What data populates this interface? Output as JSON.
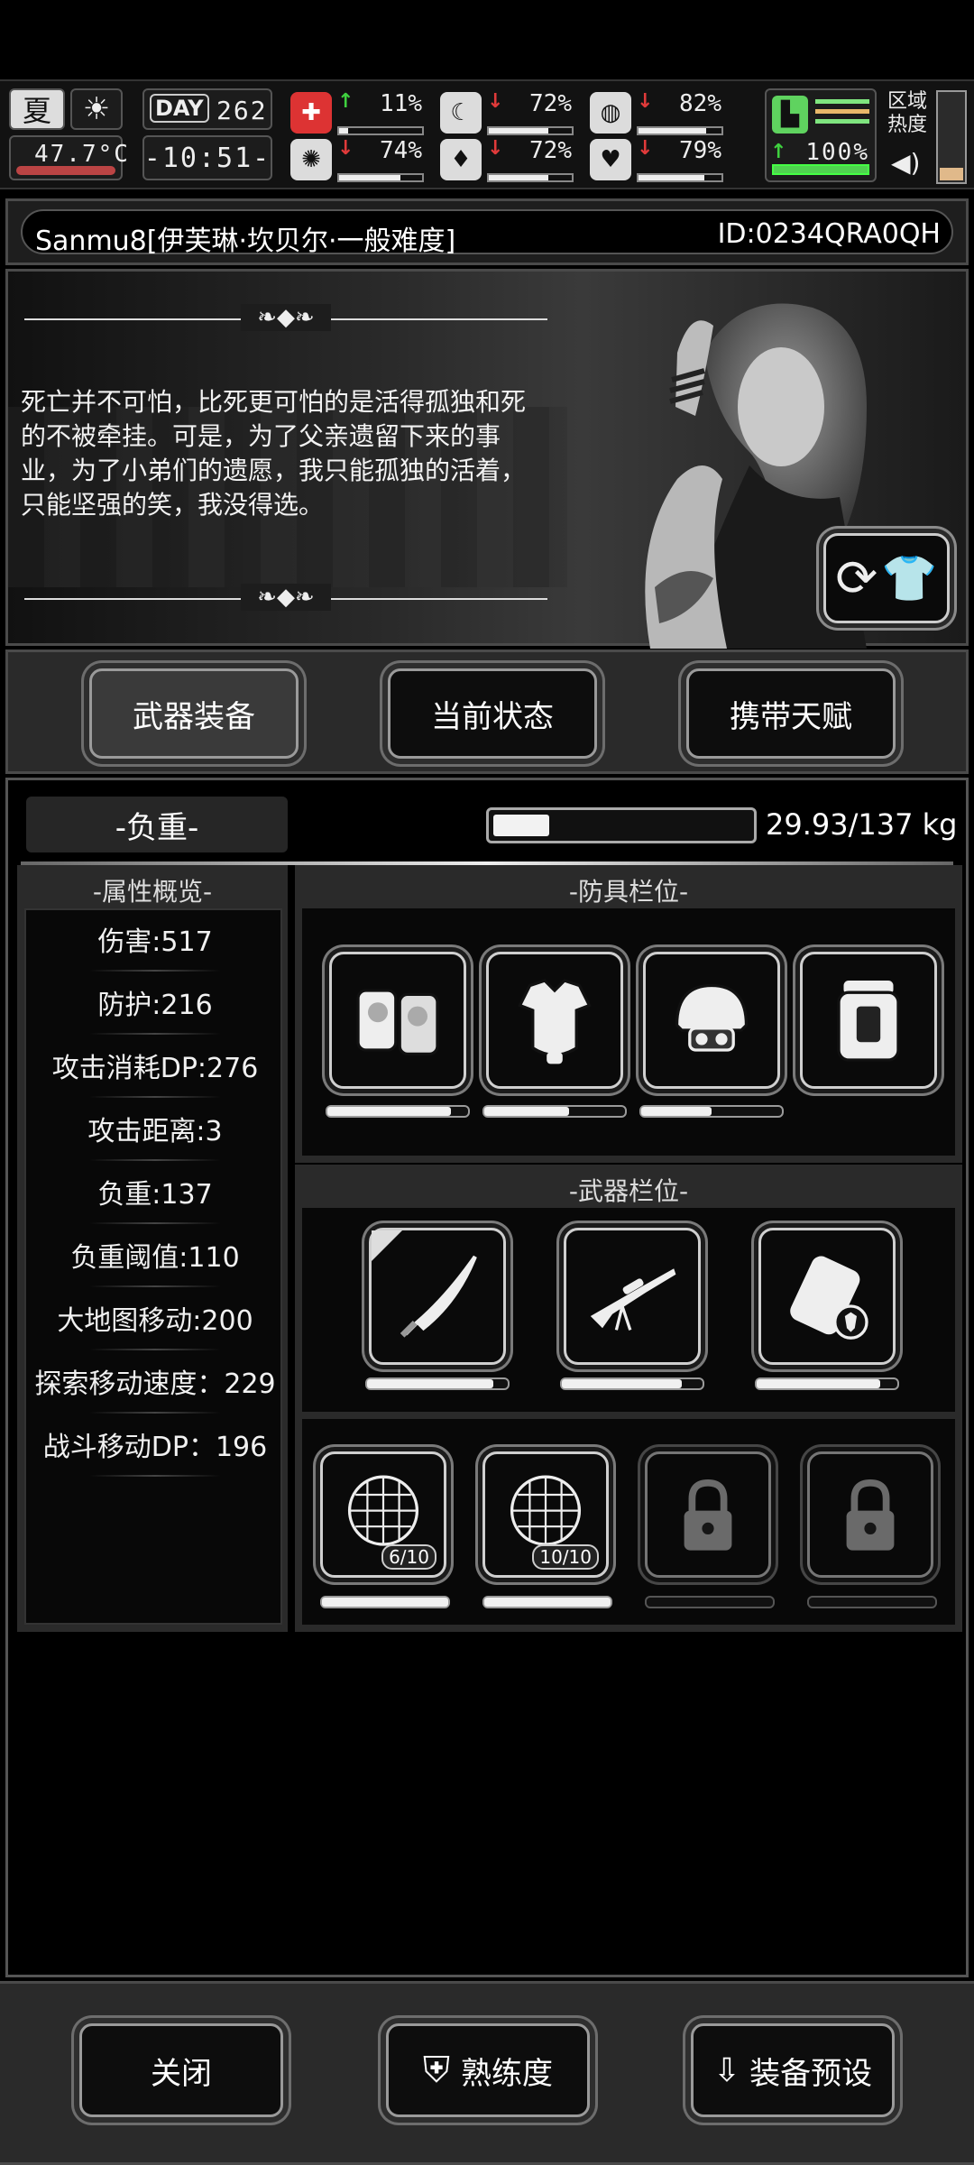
{
  "hud": {
    "season": "夏",
    "temperature": "47.7°C",
    "day_label": "DAY",
    "day_number": "262",
    "time": "-10:51-",
    "stats": [
      {
        "icon": "medkit-icon",
        "glyph": "✚",
        "arrow": "↑",
        "arrow_color": "#3fd13f",
        "value": "11%",
        "level": 0.11
      },
      {
        "icon": "stomach-icon",
        "glyph": "☾",
        "arrow": "↓",
        "arrow_color": "#e03a3a",
        "value": "72%",
        "level": 0.72
      },
      {
        "icon": "pill-icon",
        "glyph": "◍",
        "arrow": "↓",
        "arrow_color": "#e03a3a",
        "value": "82%",
        "level": 0.82
      },
      {
        "icon": "brain-icon",
        "glyph": "✺",
        "arrow": "↓",
        "arrow_color": "#e03a3a",
        "value": "74%",
        "level": 0.74
      },
      {
        "icon": "water-drop-icon",
        "glyph": "♦",
        "arrow": "↓",
        "arrow_color": "#e03a3a",
        "value": "72%",
        "level": 0.72
      },
      {
        "icon": "heart-icon",
        "glyph": "♥",
        "arrow": "↓",
        "arrow_color": "#e03a3a",
        "value": "79%",
        "level": 0.79
      }
    ],
    "stamina": {
      "arrow": "↑",
      "value": "100%",
      "level": 1.0
    },
    "zone_heat_label_1": "区域",
    "zone_heat_label_2": "热度",
    "sound_icon": "speaker-icon"
  },
  "profile": {
    "name": "Sanmu8[伊芙琳·坎贝尔·一般难度]",
    "id": "ID:0234QRA0QH"
  },
  "quote": "死亡并不可怕，比死更可怕的是活得孤独和死的不被牵挂。可是，为了父亲遗留下来的事业，为了小弟们的遗愿，我只能孤独的活着，只能坚强的笑，我没得选。",
  "tabs": [
    "武器装备",
    "当前状态",
    "携带天赋"
  ],
  "weight": {
    "title": "-负重-",
    "current": 29.93,
    "max": 137,
    "text": "29.93/137 kg"
  },
  "attributes": {
    "title": "-属性概览-",
    "items": [
      "伤害:517",
      "防护:216",
      "攻击消耗DP:276",
      "攻击距离:3",
      "负重:137",
      "负重阈值:110",
      "大地图移动:200",
      "探索移动速度：229",
      "战斗移动DP：196"
    ]
  },
  "armor": {
    "title": "-防具栏位-",
    "slots": [
      {
        "name": "gloves",
        "durability": 0.88
      },
      {
        "name": "body-armor",
        "durability": 0.6
      },
      {
        "name": "helmet",
        "durability": 0.5
      },
      {
        "name": "backpack",
        "durability": null
      }
    ]
  },
  "weapons": {
    "title": "-武器栏位-",
    "slots": [
      {
        "name": "katana",
        "durability": 0.9
      },
      {
        "name": "sniper-rifle",
        "durability": 0.85
      },
      {
        "name": "armor-plate",
        "durability": 0.88
      }
    ]
  },
  "consumables": [
    {
      "name": "net-trap",
      "count": "6/10",
      "locked": false,
      "durability": 1.0
    },
    {
      "name": "net-trap",
      "count": "10/10",
      "locked": false,
      "durability": 1.0
    },
    {
      "name": "locked-slot",
      "count": "",
      "locked": true,
      "durability": 0
    },
    {
      "name": "locked-slot",
      "count": "",
      "locked": true,
      "durability": 0
    }
  ],
  "footer": {
    "close": "关闭",
    "proficiency": "熟练度",
    "preset": "装备预设"
  }
}
